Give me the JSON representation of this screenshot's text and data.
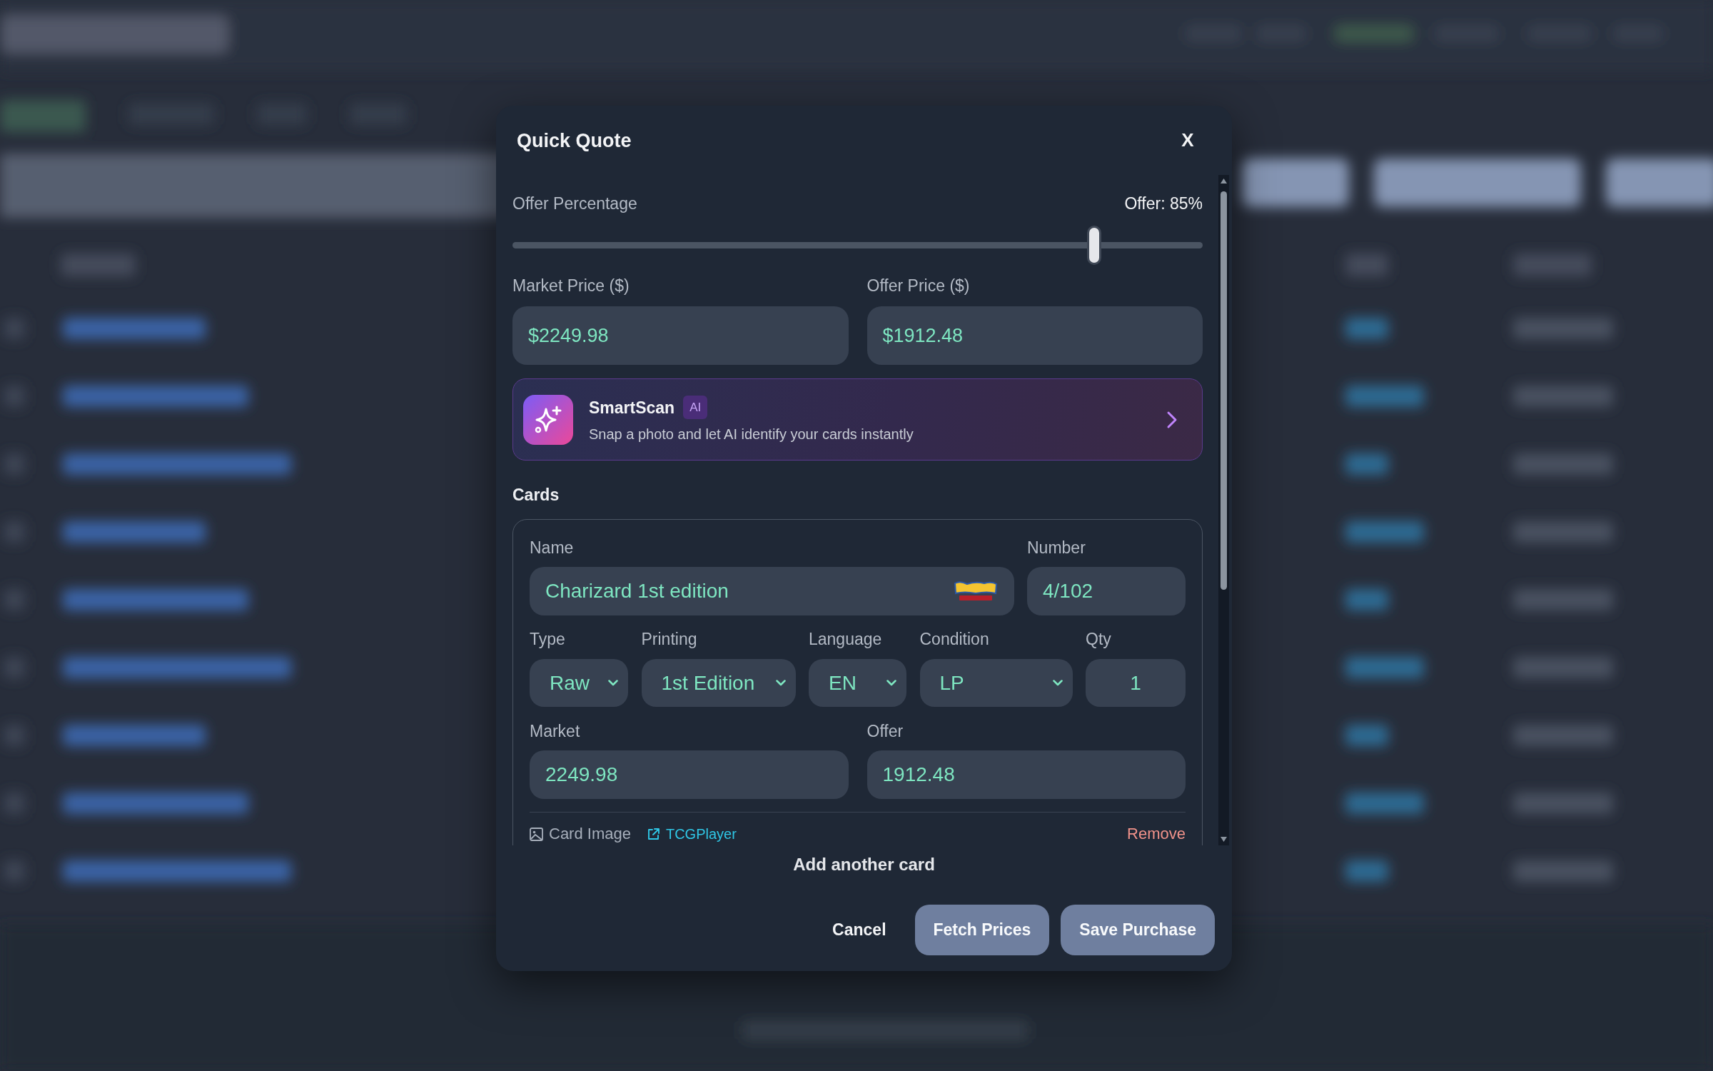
{
  "dialog": {
    "title": "Quick Quote",
    "close": "X"
  },
  "offer": {
    "label": "Offer Percentage",
    "reading": "Offer: 85%",
    "level": 0.85
  },
  "price_fields": [
    {
      "label": "Market Price ($)",
      "value": "$2249.98"
    },
    {
      "label": "Offer Price ($)",
      "value": "$1912.48"
    }
  ],
  "smartscan": {
    "title": "SmartScan",
    "badge": "AI",
    "description": "Snap a photo and let AI identify your cards instantly"
  },
  "cards": {
    "heading": "Cards",
    "items": [
      {
        "name": {
          "label": "Name",
          "value": "Charizard 1st edition"
        },
        "number": {
          "label": "Number",
          "value": "4/102"
        },
        "attributes": [
          {
            "kind": "select",
            "label": "Type",
            "value": "Raw"
          },
          {
            "kind": "select",
            "label": "Printing",
            "value": "1st Edition"
          },
          {
            "kind": "select",
            "label": "Language",
            "value": "EN"
          },
          {
            "kind": "select",
            "label": "Condition",
            "value": "LP"
          },
          {
            "kind": "number",
            "label": "Qty",
            "value": "1"
          }
        ],
        "prices": [
          {
            "label": "Market",
            "value": "2249.98"
          },
          {
            "label": "Offer",
            "value": "1912.48"
          }
        ],
        "links": [
          {
            "kind": "image",
            "label": "Card Image"
          },
          {
            "kind": "external",
            "label": "TCGPlayer"
          }
        ],
        "remove": "Remove"
      }
    ]
  },
  "add_card": "Add another card",
  "actions": [
    {
      "kind": "text",
      "label": "Cancel"
    },
    {
      "kind": "filled",
      "label": "Fetch Prices"
    },
    {
      "kind": "filled",
      "label": "Save Purchase"
    }
  ]
}
